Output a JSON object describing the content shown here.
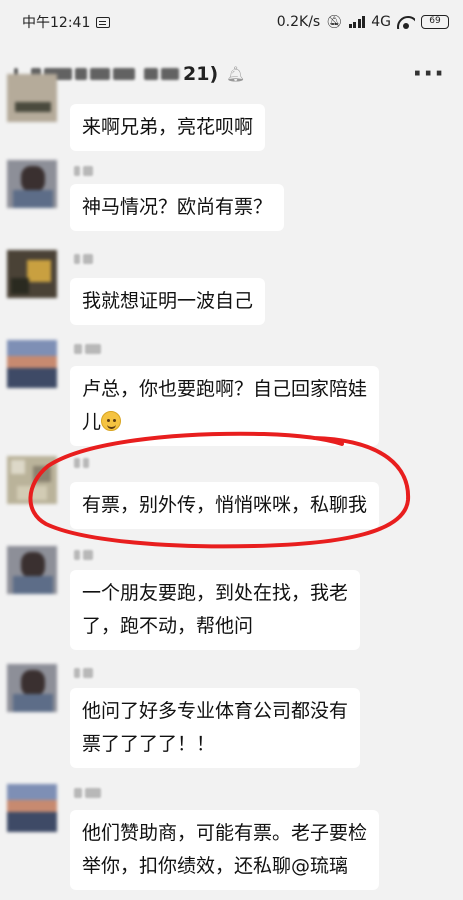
{
  "status_bar": {
    "time": "中午12:41",
    "network_speed": "0.2K/s",
    "network_type": "4G",
    "battery": "69"
  },
  "header": {
    "title_count": "21)",
    "mute_icon": "mute-bell-icon",
    "more_label": "···"
  },
  "messages": [
    {
      "text_lines": [
        "来啊兄弟，亮花呗啊"
      ]
    },
    {
      "text_lines": [
        "神马情况？欧尚有票？"
      ]
    },
    {
      "text_lines": [
        "我就想证明一波自己"
      ]
    },
    {
      "text_lines": [
        "卢总，你也要跑啊？自己回家陪娃",
        "儿"
      ],
      "emoji": "grinning-face-emoji"
    },
    {
      "text_lines": [
        "有票，别外传，悄悄咪咪，私聊我"
      ]
    },
    {
      "text_lines": [
        "一个朋友要跑，到处在找，我老",
        "了，跑不动，帮他问"
      ]
    },
    {
      "text_lines": [
        "他问了好多专业体育公司都没有",
        "票了了了了！！"
      ]
    },
    {
      "text_lines": [
        "他们赞助商，可能有票。老子要检",
        "举你，扣你绩效，还私聊@琉璃"
      ]
    }
  ],
  "colors": {
    "annotation": "#e81e1e",
    "bubble": "#ffffff",
    "background": "#f2f2f2"
  }
}
